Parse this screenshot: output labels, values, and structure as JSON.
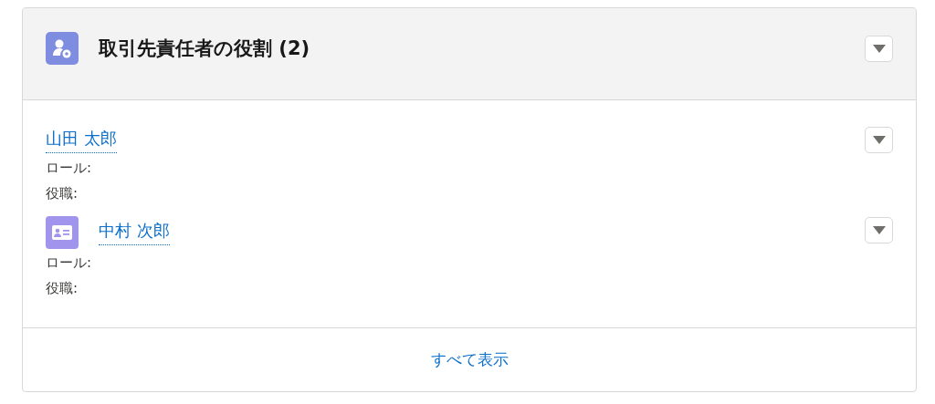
{
  "card": {
    "title": "取引先責任者の役割 (2)",
    "items": [
      {
        "kind": "plain",
        "name": "山田 太郎",
        "fields": [
          {
            "label": "ロール:"
          },
          {
            "label": "役職:"
          }
        ]
      },
      {
        "kind": "contact",
        "name": "中村 次郎",
        "fields": [
          {
            "label": "ロール:"
          },
          {
            "label": "役職:"
          }
        ]
      }
    ],
    "footer_link": "すべて表示"
  }
}
